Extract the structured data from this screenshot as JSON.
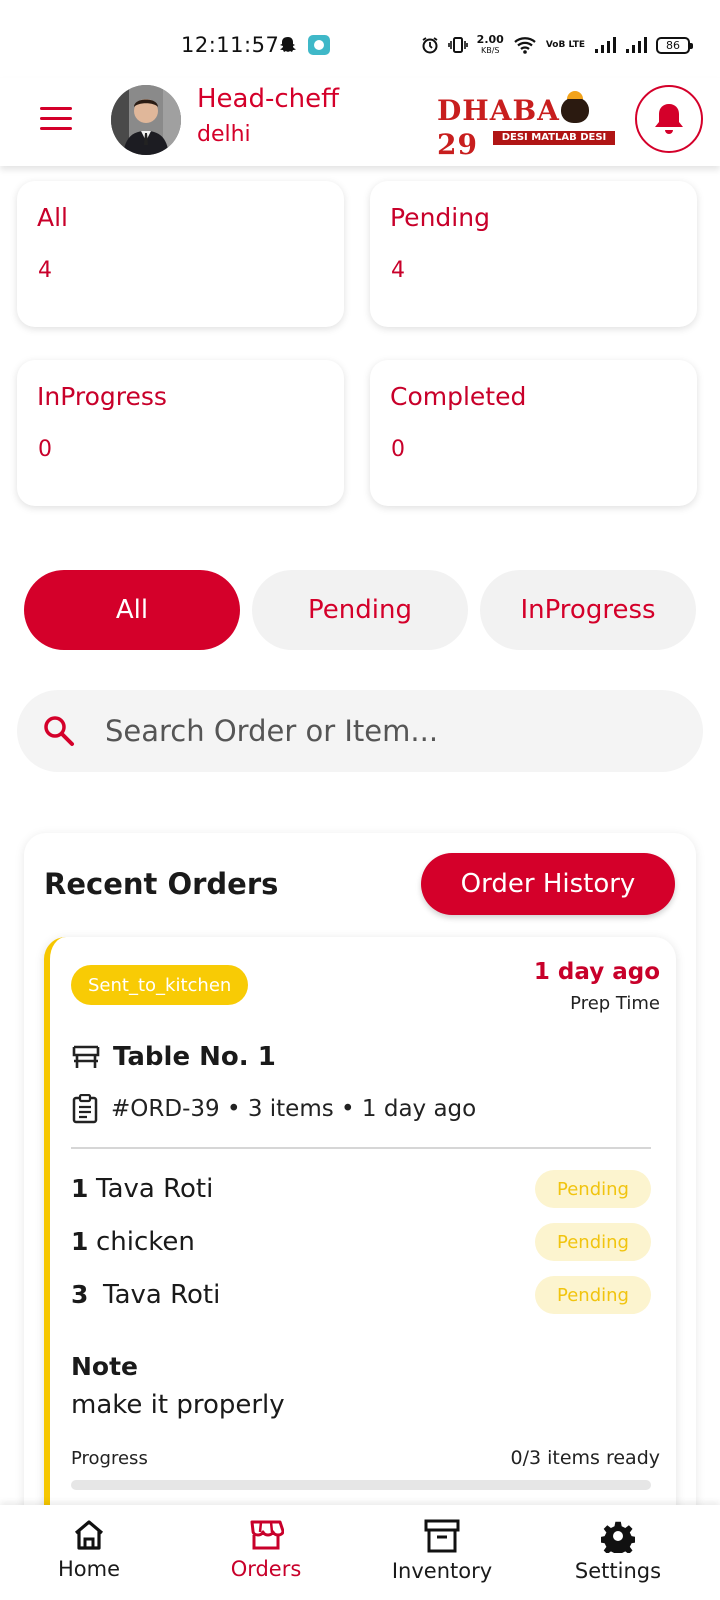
{
  "status_bar": {
    "time": "12:11:57",
    "net_speed": "2.00",
    "net_unit": "KB/S",
    "volte": "VoB LTE",
    "battery": "86"
  },
  "header": {
    "user_name": "Head-cheff",
    "user_city": "delhi",
    "logo_left": "DHABA",
    "logo_right": "29",
    "logo_tagline": "DESI MATLAB DESI",
    "accent_color": "#d4002a"
  },
  "stats": [
    {
      "label": "All",
      "value": "4"
    },
    {
      "label": "Pending",
      "value": "4"
    },
    {
      "label": "InProgress",
      "value": "0"
    },
    {
      "label": "Completed",
      "value": "0"
    }
  ],
  "filters": [
    "All",
    "Pending",
    "InProgress"
  ],
  "active_filter": "All",
  "search": {
    "placeholder": "Search Order or Item...",
    "value": ""
  },
  "recent_orders": {
    "title": "Recent Orders",
    "history_button": "Order History",
    "order": {
      "status": "Sent_to_kitchen",
      "age": "1 day ago",
      "prep_label": "Prep Time",
      "table": "Table No. 1",
      "meta": "#ORD-39 • 3 items • 1 day ago",
      "items": [
        {
          "qty": "1",
          "name": "Tava Roti",
          "status": "Pending"
        },
        {
          "qty": "1",
          "name": "chicken",
          "status": "Pending"
        },
        {
          "qty": "3",
          "name": "Tava Roti",
          "status": "Pending"
        }
      ],
      "note_label": "Note",
      "note": "make it properly",
      "progress_label": "Progress",
      "progress_text": "0/3 items ready",
      "progress_fraction": 0
    }
  },
  "nav": [
    {
      "label": "Home",
      "icon": "home-icon"
    },
    {
      "label": "Orders",
      "icon": "store-icon"
    },
    {
      "label": "Inventory",
      "icon": "archive-box-icon"
    },
    {
      "label": "Settings",
      "icon": "gear-icon"
    }
  ],
  "active_nav": "Orders"
}
